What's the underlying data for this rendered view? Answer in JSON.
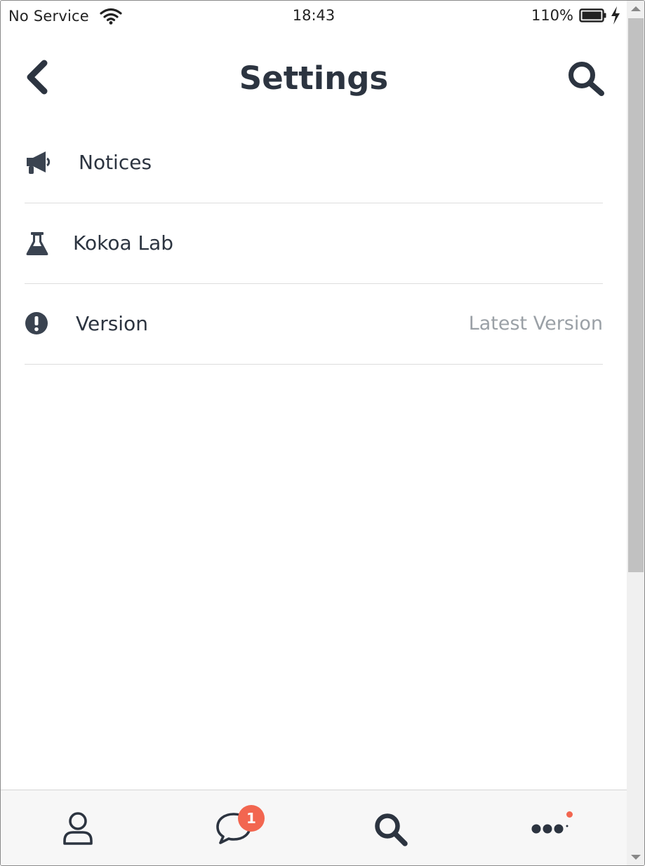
{
  "status_bar": {
    "carrier": "No Service",
    "time": "18:43",
    "battery": "110%"
  },
  "header": {
    "title": "Settings",
    "back_icon": "chevron-left-icon",
    "search_icon": "search-icon"
  },
  "settings": {
    "items": [
      {
        "label": "Notices",
        "icon": "megaphone-icon",
        "value": ""
      },
      {
        "label": "Kokoa Lab",
        "icon": "flask-icon",
        "value": ""
      },
      {
        "label": "Version",
        "icon": "exclamation-circle-icon",
        "value": "Latest Version"
      }
    ]
  },
  "tabbar": {
    "tabs": [
      {
        "icon": "user-icon"
      },
      {
        "icon": "chat-bubble-icon",
        "badge": "1"
      },
      {
        "icon": "search-icon"
      },
      {
        "icon": "more-dots-icon"
      }
    ]
  },
  "colors": {
    "text": "#2c3440",
    "muted": "#9aa0a6",
    "divider": "#dddddd",
    "badge": "#f26650",
    "tabbar_bg": "#f7f7f7"
  }
}
